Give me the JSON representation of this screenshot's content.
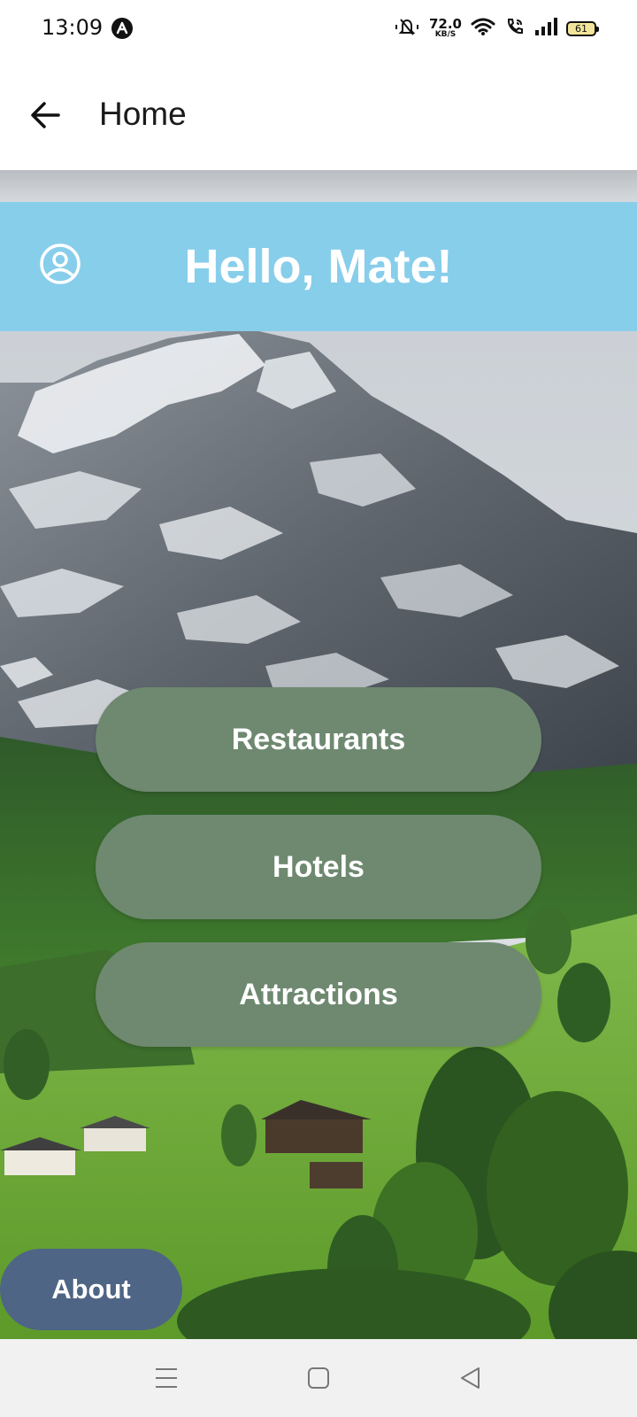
{
  "status_bar": {
    "time": "13:09",
    "net_speed_value": "72.0",
    "net_speed_unit": "KB/S",
    "battery": "61",
    "icons": [
      "app-notification-icon",
      "mute-icon",
      "wifi-icon",
      "wifi-calling-icon",
      "signal-icon",
      "battery-icon"
    ]
  },
  "app_bar": {
    "title": "Home",
    "back_icon": "arrow-back-icon"
  },
  "header": {
    "greeting": "Hello, Mate!",
    "profile_icon": "account-circle-icon",
    "background_color": "#87ceeb"
  },
  "menu": {
    "buttons": [
      {
        "label": "Restaurants"
      },
      {
        "label": "Hotels"
      },
      {
        "label": "Attractions"
      }
    ],
    "button_color": "#6e8970"
  },
  "about_button": {
    "label": "About",
    "color": "#4e6585"
  },
  "nav_bar": {
    "items": [
      "menu-icon",
      "home-square-icon",
      "back-triangle-icon"
    ]
  }
}
